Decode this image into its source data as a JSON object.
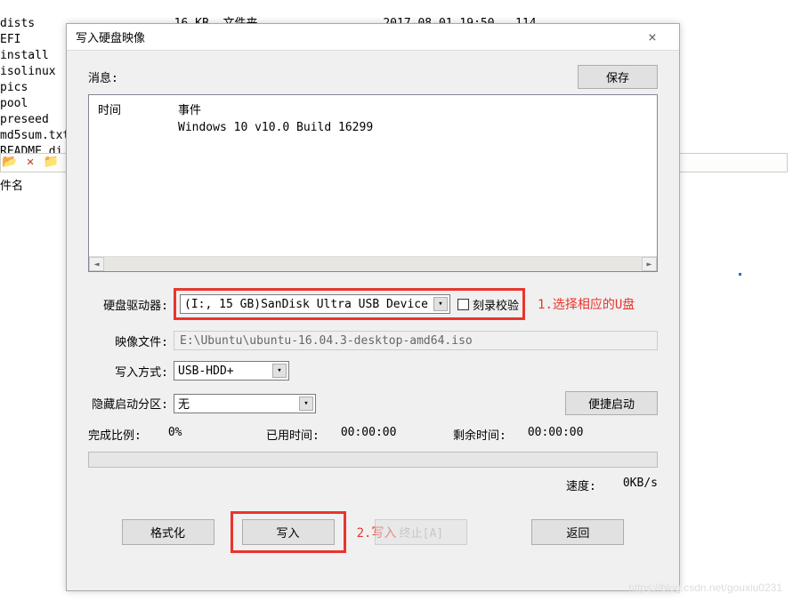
{
  "background": {
    "files": [
      {
        "name": "dists",
        "size": "16 KB",
        "type": "文件夹",
        "date": "2017-08-01 19:50",
        "extra": "114"
      },
      {
        "name": "EFI"
      },
      {
        "name": "install"
      },
      {
        "name": "isolinux"
      },
      {
        "name": "pics"
      },
      {
        "name": "pool"
      },
      {
        "name": "preseed"
      },
      {
        "name": "md5sum.txt"
      },
      {
        "name": "README.di…"
      }
    ],
    "col_label": "件名"
  },
  "dialog": {
    "title": "写入硬盘映像",
    "msg_label": "消息:",
    "save_btn": "保存",
    "log": {
      "col_time": "时间",
      "col_event": "事件",
      "event_text": "Windows 10 v10.0 Build 16299"
    },
    "form": {
      "drive_label": "硬盘驱动器:",
      "drive_value": "(I:, 15 GB)SanDisk Ultra USB Device",
      "verify_label": "刻录校验",
      "image_label": "映像文件:",
      "image_value": "E:\\Ubuntu\\ubuntu-16.04.3-desktop-amd64.iso",
      "method_label": "写入方式:",
      "method_value": "USB-HDD+",
      "hide_label": "隐藏启动分区:",
      "hide_value": "无",
      "quickboot_btn": "便捷启动"
    },
    "stats": {
      "percent_label": "完成比例:",
      "percent_value": "0%",
      "elapsed_label": "已用时间:",
      "elapsed_value": "00:00:00",
      "remain_label": "剩余时间:",
      "remain_value": "00:00:00",
      "speed_label": "速度:",
      "speed_value": "0KB/s"
    },
    "buttons": {
      "format": "格式化",
      "write": "写入",
      "stop": "终止[A]",
      "back": "返回"
    }
  },
  "annotations": {
    "step1": "1.选择相应的U盘",
    "step2": "2.写入"
  },
  "watermark": "https://blog.csdn.net/gouxiu0231"
}
